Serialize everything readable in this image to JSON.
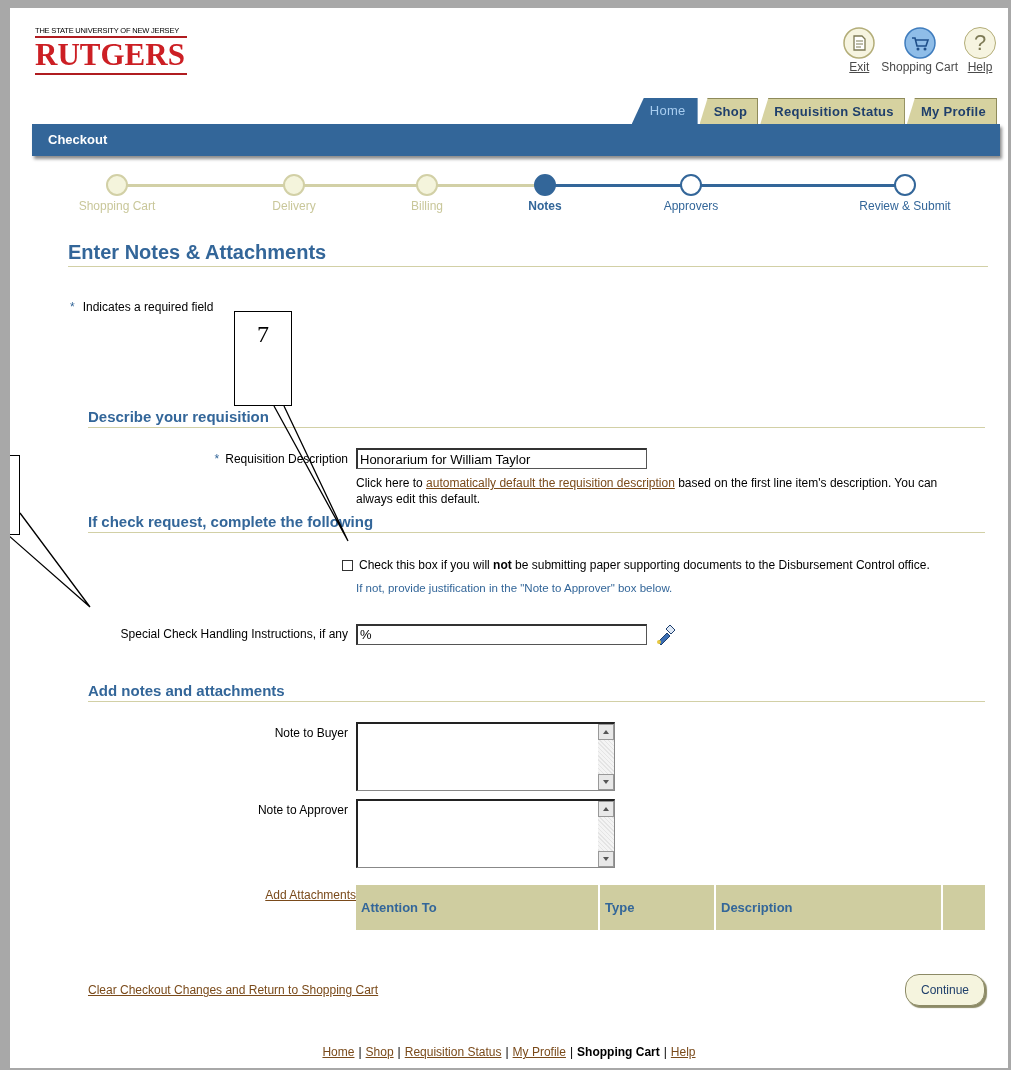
{
  "header": {
    "logo": {
      "tagline": "THE STATE UNIVERSITY OF NEW JERSEY",
      "name": "RUTGERS"
    },
    "global_buttons": [
      {
        "label": "Exit",
        "kind": "exit",
        "link": true
      },
      {
        "label": "Shopping Cart",
        "kind": "cart",
        "link": false
      },
      {
        "label": "Help",
        "kind": "help",
        "link": true,
        "glyph": "?"
      }
    ]
  },
  "tabs": [
    {
      "label": "Home",
      "selected": true
    },
    {
      "label": "Shop",
      "selected": false
    },
    {
      "label": "Requisition Status",
      "selected": false
    },
    {
      "label": "My Profile",
      "selected": false
    }
  ],
  "page_bar": {
    "title": "Checkout"
  },
  "train": [
    {
      "label": "Shopping Cart",
      "visited": true,
      "selected": false
    },
    {
      "label": "Delivery",
      "visited": true,
      "selected": false
    },
    {
      "label": "Billing",
      "visited": true,
      "selected": false
    },
    {
      "label": "Notes",
      "visited": false,
      "selected": true
    },
    {
      "label": "Approvers",
      "visited": false,
      "selected": false
    },
    {
      "label": "Review & Submit",
      "visited": false,
      "selected": false
    }
  ],
  "page_title": "Enter Notes & Attachments",
  "required_note": {
    "marker": "*",
    "text": "Indicates a required field"
  },
  "describe_section": {
    "heading": "Describe your requisition",
    "field": {
      "required_marker": "*",
      "label": "Requisition Description",
      "value": "Honorarium for William Taylor"
    },
    "help_before": "Click here to ",
    "help_link": "automatically default the requisition description",
    "help_after": " based on the first line item's description. You can always edit this default."
  },
  "check_section": {
    "heading": "If check request, complete the following",
    "checkbox": {
      "label": "Check this box if you will **not** be submitting paper supporting documents to the Disbursement Control office.",
      "checked": false
    },
    "hint": "If not, provide justification in the \"Note to Approver\" box below.",
    "special_field": {
      "label": "Special Check Handling Instructions, if any",
      "value": "%"
    }
  },
  "notes_section": {
    "heading": "Add notes and attachments",
    "notes": [
      {
        "label": "Note to Buyer"
      },
      {
        "label": "Note to Approver"
      }
    ],
    "attachments": {
      "link": "Add Attachments",
      "columns": [
        "Attention To",
        "Type",
        "Description"
      ]
    }
  },
  "clear_link": "Clear Checkout Changes and Return to Shopping Cart",
  "continue_button": "Continue",
  "footer": {
    "separator": "|",
    "links": [
      {
        "label": "Home",
        "selected": false
      },
      {
        "label": "Shop",
        "selected": false
      },
      {
        "label": "Requisition Status",
        "selected": false
      },
      {
        "label": "My Profile",
        "selected": false
      },
      {
        "label": "Shopping Cart",
        "selected": true
      },
      {
        "label": "Help",
        "selected": false
      }
    ]
  },
  "annotations": [
    {
      "kind": "callout",
      "label": "7"
    },
    {
      "kind": "callout"
    }
  ]
}
